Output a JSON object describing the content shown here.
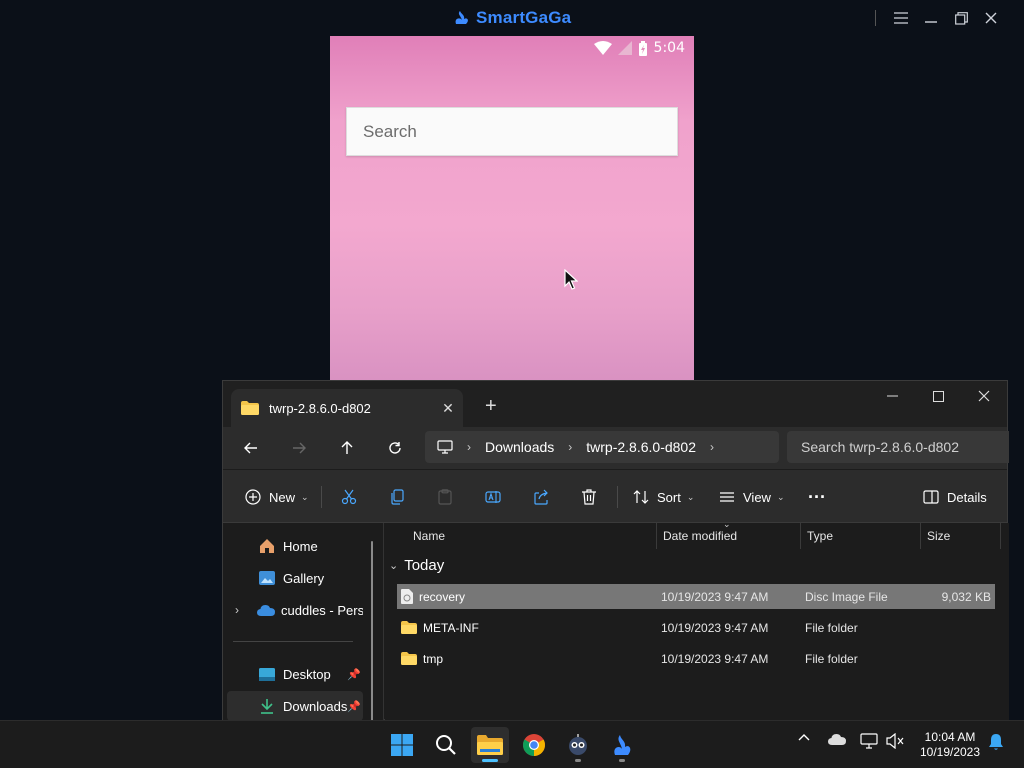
{
  "emulator": {
    "brand": "SmartGaGa",
    "controls": [
      "menu-icon",
      "minimize-icon",
      "restore-icon",
      "close-icon"
    ]
  },
  "phone": {
    "status_time": "5:04",
    "search_placeholder": "Search",
    "colors": {
      "gradient_top": "#e07fb8",
      "gradient_mid": "#f3a8cf"
    }
  },
  "explorer": {
    "tab_title": "twrp-2.8.6.0-d802",
    "breadcrumb": [
      "Downloads",
      "twrp-2.8.6.0-d802"
    ],
    "search_placeholder": "Search twrp-2.8.6.0-d802",
    "toolbar": {
      "new_label": "New",
      "sort_label": "Sort",
      "view_label": "View",
      "details_label": "Details"
    },
    "sidebar": [
      {
        "label": "Home",
        "icon": "home-icon"
      },
      {
        "label": "Gallery",
        "icon": "gallery-icon"
      },
      {
        "label": "cuddles - Persor",
        "icon": "onedrive-icon"
      },
      {
        "label": "Desktop",
        "icon": "desktop-icon"
      },
      {
        "label": "Downloads",
        "icon": "downloads-icon"
      }
    ],
    "columns": [
      "Name",
      "Date modified",
      "Type",
      "Size"
    ],
    "group_label": "Today",
    "files": [
      {
        "name": "recovery",
        "date": "10/19/2023 9:47 AM",
        "type": "Disc Image File",
        "size": "9,032 KB",
        "icon": "disc-image-icon"
      },
      {
        "name": "META-INF",
        "date": "10/19/2023 9:47 AM",
        "type": "File folder",
        "size": "",
        "icon": "folder-icon"
      },
      {
        "name": "tmp",
        "date": "10/19/2023 9:47 AM",
        "type": "File folder",
        "size": "",
        "icon": "folder-icon"
      }
    ]
  },
  "taskbar": {
    "apps": [
      "windows-start-icon",
      "search-icon",
      "file-explorer-icon",
      "chrome-icon",
      "robot-app-icon",
      "smartgaga-icon"
    ],
    "time": "10:04 AM",
    "date": "10/19/2023"
  }
}
